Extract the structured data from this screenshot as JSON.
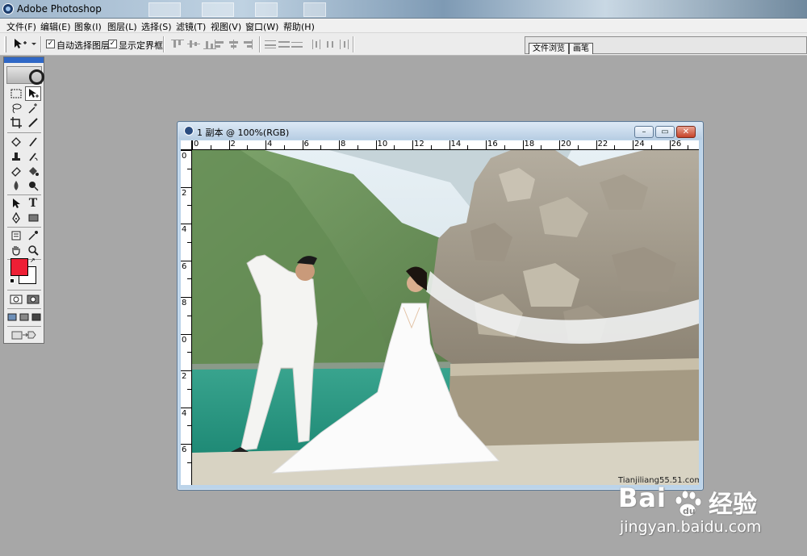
{
  "window": {
    "title": "Adobe Photoshop"
  },
  "menu": [
    "文件(F)",
    "编辑(E)",
    "图象(I)",
    "图层(L)",
    "选择(S)",
    "滤镜(T)",
    "视图(V)",
    "窗口(W)",
    "帮助(H)"
  ],
  "options": {
    "auto_select_layer": {
      "label": "自动选择图层",
      "checked": true
    },
    "show_bounding_box": {
      "label": "显示定界框",
      "checked": true
    }
  },
  "palette_well": {
    "tabs": [
      "文件浏览",
      "画笔"
    ]
  },
  "toolbox": {
    "colors": {
      "foreground": "#ee1f35",
      "background": "#ffffff"
    }
  },
  "document": {
    "title": "1 副本 @ 100%(RGB)",
    "ruler_h": [
      "0",
      "2",
      "4",
      "6",
      "8",
      "10",
      "12",
      "14",
      "16",
      "18",
      "20",
      "22",
      "24",
      "26"
    ],
    "ruler_v": [
      "0",
      "2",
      "4",
      "6",
      "8",
      "0",
      "2",
      "4",
      "6"
    ],
    "photo_watermark": "Tianjiliang55.51.com"
  },
  "overlay": {
    "brand": "Bai",
    "brand_suffix": "经验",
    "url": "jingyan.baidu.com"
  }
}
